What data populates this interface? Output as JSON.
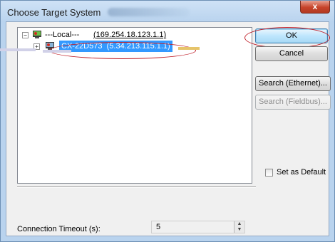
{
  "window": {
    "title": "Choose Target System",
    "close_glyph": "x"
  },
  "tree": {
    "root": {
      "expander": "−",
      "label": "---Local---",
      "address": "(169.254.18.123.1.1)",
      "icon": "target-system-icon"
    },
    "child": {
      "expander": "+",
      "label": "CX-22D573",
      "address": "(5.34.213.115.1.1)",
      "icon": "target-system-icon",
      "selected": true
    }
  },
  "buttons": {
    "ok": "OK",
    "cancel": "Cancel",
    "search_ethernet": "Search (Ethernet)...",
    "search_fieldbus": "Search (Fieldbus)..."
  },
  "set_as_default": {
    "label": "Set as Default",
    "checked": false
  },
  "timeout": {
    "label": "Connection Timeout (s):",
    "value": "5"
  },
  "colors": {
    "selection": "#3399ff",
    "highlight_ellipse": "#c0202a"
  }
}
